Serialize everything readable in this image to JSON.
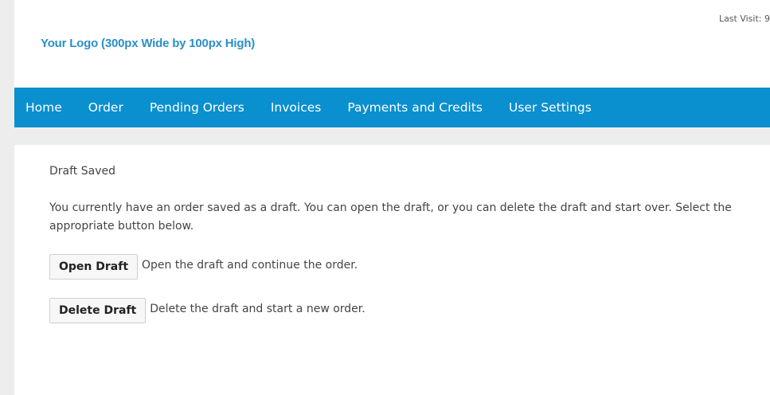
{
  "header": {
    "last_visit": "Last Visit: 9",
    "logo_text": "Your Logo (300px Wide by 100px High)"
  },
  "nav": {
    "items": [
      {
        "label": "Home"
      },
      {
        "label": "Order"
      },
      {
        "label": "Pending Orders"
      },
      {
        "label": "Invoices"
      },
      {
        "label": "Payments and Credits"
      },
      {
        "label": "User Settings"
      }
    ]
  },
  "main": {
    "title": "Draft Saved",
    "message": "You currently have an order saved as a draft. You can open the draft, or you can delete the draft and start over. Select the appropriate button below.",
    "open_draft": {
      "label": "Open Draft",
      "description": "Open the draft and continue the order."
    },
    "delete_draft": {
      "label": "Delete Draft",
      "description": "Delete the draft and start a new order."
    }
  },
  "colors": {
    "nav_background": "#0a8fcf",
    "logo_text": "#2a8fc9",
    "page_background": "#ededed"
  }
}
